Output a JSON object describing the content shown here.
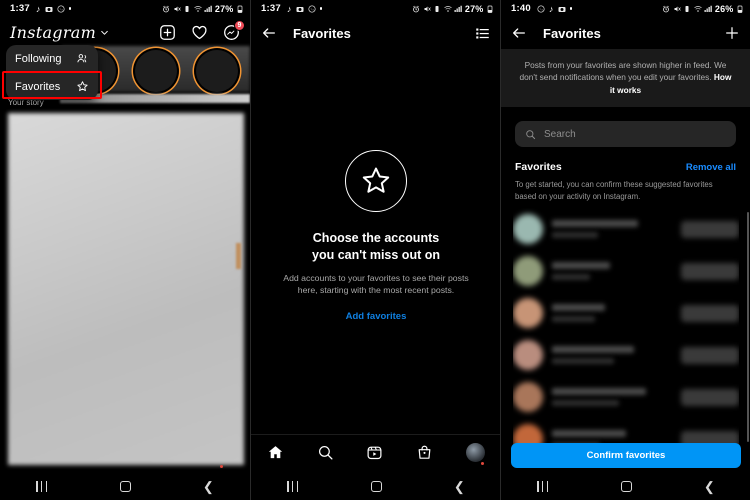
{
  "panel1": {
    "status": {
      "time": "1:37",
      "battery": "27%",
      "icons": [
        "tiktok-icon",
        "camera-icon",
        "whatsapp-icon",
        "dot-icon"
      ],
      "right_icons": [
        "alarm-icon",
        "mute-icon",
        "vibrate-icon",
        "wifi-icon",
        "signal-icon"
      ]
    },
    "header": {
      "logo": "Instagram",
      "chevron": "chevron-down-icon",
      "icons": [
        "plus-box-icon",
        "heart-icon",
        "messenger-icon"
      ],
      "message_badge": "9"
    },
    "dropdown": {
      "items": [
        {
          "label": "Following",
          "icon": "people-icon",
          "highlighted": false
        },
        {
          "label": "Favorites",
          "icon": "star-icon",
          "highlighted": true
        }
      ],
      "highlight_color": "#FF0000"
    },
    "story": {
      "label": "Your story"
    }
  },
  "panel2": {
    "status": {
      "time": "1:37",
      "battery": "27%"
    },
    "header": {
      "back": "back-arrow-icon",
      "title": "Favorites",
      "action": "list-icon"
    },
    "empty_state": {
      "icon": "star-circle-icon",
      "title": "Choose the accounts\nyou can't miss out on",
      "title_line1": "Choose the accounts",
      "title_line2": "you can't miss out on",
      "body": "Add accounts to your favorites to see their posts here, starting with the most recent posts.",
      "link": "Add favorites",
      "link_color": "#0f7fe0"
    },
    "bottom_nav": [
      {
        "name": "home-icon",
        "label": "Home"
      },
      {
        "name": "search-icon",
        "label": "Search"
      },
      {
        "name": "reels-icon",
        "label": "Reels"
      },
      {
        "name": "shop-icon",
        "label": "Shop"
      },
      {
        "name": "profile-avatar",
        "label": "Profile"
      }
    ]
  },
  "panel3": {
    "status": {
      "time": "1:40",
      "battery": "26%"
    },
    "header": {
      "back": "back-arrow-icon",
      "title": "Favorites",
      "action": "plus-icon"
    },
    "notice": {
      "text": "Posts from your favorites are shown higher in feed. We don't send notifications when you edit your favorites. ",
      "link": "How it works"
    },
    "search": {
      "placeholder": "Search",
      "icon": "search-icon"
    },
    "section": {
      "title": "Favorites",
      "action": "Remove all",
      "action_color": "#1a8cff",
      "subtitle": "To get started, you can confirm these suggested favorites based on your activity on Instagram."
    },
    "accounts": [
      {
        "redacted": true,
        "avatar_color": "#9ab8b0",
        "name_width": "72%",
        "sub_width": "38%"
      },
      {
        "redacted": true,
        "avatar_color": "#8f9b79",
        "name_width": "48%",
        "sub_width": "32%"
      },
      {
        "redacted": true,
        "avatar_color": "#c79476",
        "name_width": "44%",
        "sub_width": "36%"
      },
      {
        "redacted": true,
        "avatar_color": "#b98d7e",
        "name_width": "68%",
        "sub_width": "52%"
      },
      {
        "redacted": true,
        "avatar_color": "#a9765a",
        "name_width": "78%",
        "sub_width": "56%"
      },
      {
        "redacted": true,
        "avatar_color": "#c2673a",
        "name_width": "62%",
        "sub_width": "40%"
      }
    ],
    "confirm_button": {
      "label": "Confirm favorites",
      "color": "#0095F6"
    }
  },
  "android_nav": {
    "recent": "recents-icon",
    "home": "home-square-icon",
    "back": "back-chevron-icon"
  }
}
